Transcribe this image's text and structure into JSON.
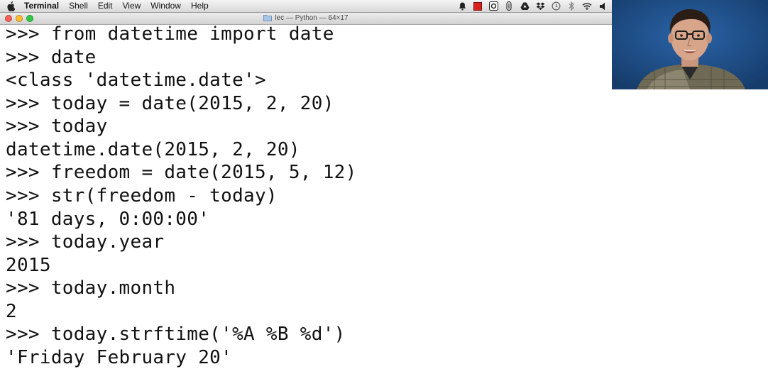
{
  "menubar": {
    "apple_icon": "apple-logo-icon",
    "app_name": "Terminal",
    "menus": [
      "Shell",
      "Edit",
      "View",
      "Window",
      "Help"
    ],
    "status_icons": [
      "notification-bell-icon",
      "red-square-icon",
      "app-icon",
      "script-icon",
      "drive-icon",
      "dropbox-icon",
      "time-machine-icon",
      "bluetooth-icon",
      "wifi-icon",
      "volume-icon"
    ]
  },
  "window": {
    "title": "lec — Python — 64×17",
    "folder_icon": "folder-icon"
  },
  "terminal": {
    "lines": [
      ">>> from datetime import date",
      ">>> date",
      "<class 'datetime.date'>",
      ">>> today = date(2015, 2, 20)",
      ">>> today",
      "datetime.date(2015, 2, 20)",
      ">>> freedom = date(2015, 5, 12)",
      ">>> str(freedom - today)",
      "'81 days, 0:00:00'",
      ">>> today.year",
      "2015",
      ">>> today.month",
      "2",
      ">>> today.strftime('%A %B %d')",
      "'Friday February 20'"
    ]
  },
  "colors": {
    "terminal_bg": "#ffffff",
    "terminal_text": "#111111",
    "webcam_bg": "#1e4e86"
  }
}
